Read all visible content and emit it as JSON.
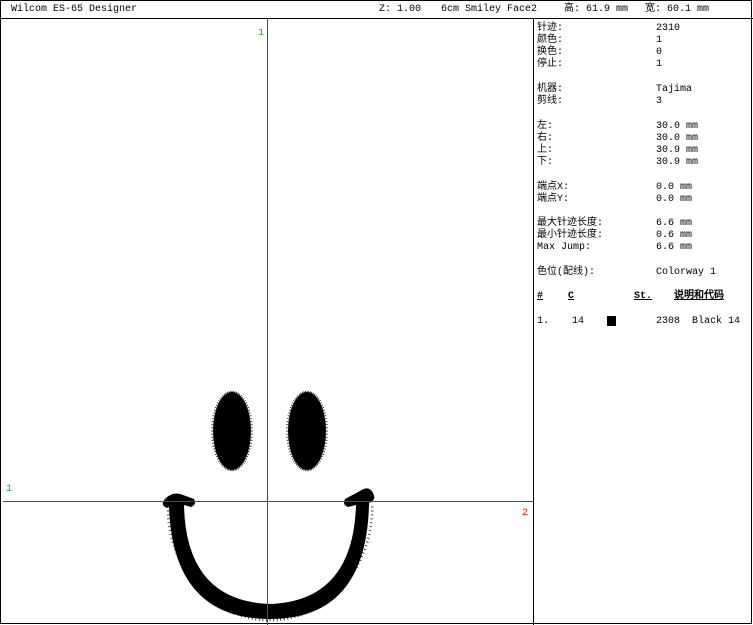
{
  "titlebar": {
    "app_title": "Wilcom ES-65 Designer",
    "zoom": "Z: 1.00",
    "design_name": "6cm Smiley Face2",
    "height_label": "高: 61.9 mm",
    "width_label": "宽: 60.1 mm"
  },
  "canvas": {
    "axis_v_top_label": "1",
    "axis_h_left_label": "1",
    "axis_h_right_label": "2",
    "stitch_color": "#000000",
    "axis_color": "#ff0000",
    "label_green": "#00c000",
    "label_red": "#ff0000"
  },
  "info": {
    "stitches": {
      "label": "针迹:",
      "value": "2310"
    },
    "colors": {
      "label": "颜色:",
      "value": "1"
    },
    "color_changes": {
      "label": "换色:",
      "value": "0"
    },
    "stops": {
      "label": "停止:",
      "value": "1"
    },
    "machine": {
      "label": "机器:",
      "value": "Tajima"
    },
    "trims": {
      "label": "剪线:",
      "value": "3"
    },
    "left": {
      "label": "左:",
      "value": "30.0 mm"
    },
    "right": {
      "label": "右:",
      "value": "30.0 mm"
    },
    "up": {
      "label": "上:",
      "value": "30.9 mm"
    },
    "down": {
      "label": "下:",
      "value": "30.9 mm"
    },
    "end_x": {
      "label": "端点X:",
      "value": "0.0 mm"
    },
    "end_y": {
      "label": "端点Y:",
      "value": "0.0 mm"
    },
    "max_stitch": {
      "label": "最大针迹长度:",
      "value": "6.6 mm"
    },
    "min_stitch": {
      "label": "最小针迹长度:",
      "value": "0.6 mm"
    },
    "max_jump": {
      "label": "Max Jump:",
      "value": "6.6 mm"
    },
    "colorway": {
      "label": "色位(配线):",
      "value": "Colorway 1"
    }
  },
  "color_table": {
    "headers": {
      "num": "#",
      "code": "C",
      "stitches": "St.",
      "desc": "说明和代码"
    },
    "rows": [
      {
        "num": "1.",
        "code": "14",
        "swatch": "#000000",
        "stitches": "2308",
        "desc": "Black 14"
      }
    ]
  }
}
